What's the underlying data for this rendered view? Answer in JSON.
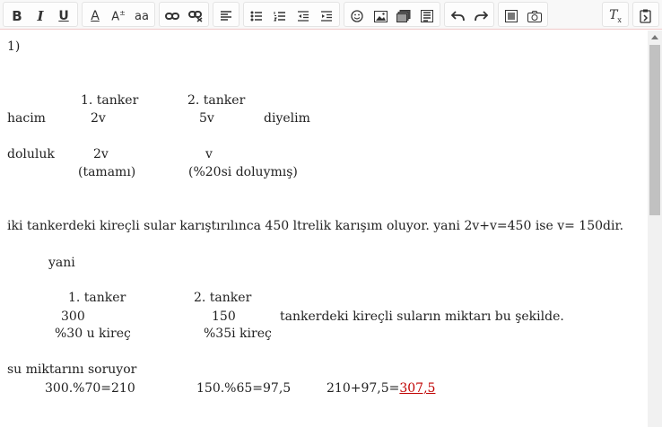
{
  "toolbar": {
    "bold": "B",
    "italic": "I",
    "underline": "U",
    "font_color": "A",
    "font_size": "A",
    "font_size_sup": "±",
    "case": "aa",
    "clear_format": "T",
    "clear_format_sub": "x"
  },
  "content": {
    "line1": "1)",
    "tanker1_header": "1. tanker",
    "tanker2_header": "2. tanker",
    "hacim_label": "hacim",
    "hacim_v1": "2v",
    "hacim_v2": "5v",
    "diyelim": "diyelim",
    "doluluk_label": "doluluk",
    "doluluk_v1": "2v",
    "doluluk_v2": "v",
    "tamami": "(tamamı)",
    "yuzde20": "(%20si doluymış)",
    "sentence": "iki tankerdeki kireçli sular karıştırılınca 450 ltrelik karışım oluyor. yani 2v+v=450 ise v= 150dir.",
    "yani": "yani",
    "tanker1_header_b": "1. tanker",
    "tanker2_header_b": "2. tanker",
    "amount1": "300",
    "amount2": "150",
    "amount_note": "tankerdeki kireçli suların miktarı bu şekilde.",
    "kirec1": "%30 u kireç",
    "kirec2": "%35i kireç",
    "su_miktari": "su miktarını soruyor",
    "calc1": "300.%70=210",
    "calc2": "150.%65=97,5",
    "calc3_prefix": "210+97,5=",
    "calc3_result": "307,5"
  }
}
